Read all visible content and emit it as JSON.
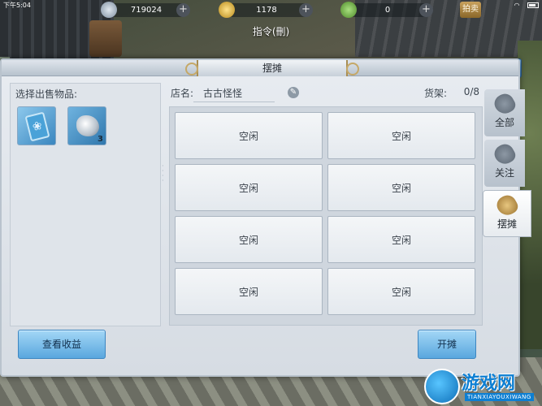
{
  "status_bar": {
    "time": "下午5:04"
  },
  "currencies": [
    {
      "icon": "silver-coin-icon",
      "value": "719024"
    },
    {
      "icon": "gold-coin-icon",
      "value": "1178"
    },
    {
      "icon": "jade-icon",
      "value": "0"
    }
  ],
  "top_right_button": {
    "label": "拍卖"
  },
  "command_title": "指令(刪)",
  "panel": {
    "title": "摆摊",
    "close_label": "✕",
    "select_label": "选择出售物品:",
    "items": [
      {
        "icon": "jade-tablet-icon",
        "count": ""
      },
      {
        "icon": "ore-crystal-icon",
        "count": "3"
      }
    ],
    "shop_name_label": "店名:",
    "shop_name_value": "古古怪怪",
    "shelf_label": "货架:",
    "shelf_count": "0/8",
    "slots": [
      "空闲",
      "空闲",
      "空闲",
      "空闲",
      "空闲",
      "空闲",
      "空闲",
      "空闲"
    ],
    "tabs": [
      {
        "label": "全部"
      },
      {
        "label": "关注"
      },
      {
        "label": "摆摊"
      }
    ],
    "earnings_button": "查看收益",
    "open_button": "开摊"
  },
  "watermark": {
    "text": "游戏网",
    "sub": "TIANXIAYOUXIWANG"
  },
  "colors": {
    "accent": "#5aa7de",
    "panel": "#e8ecf1"
  }
}
